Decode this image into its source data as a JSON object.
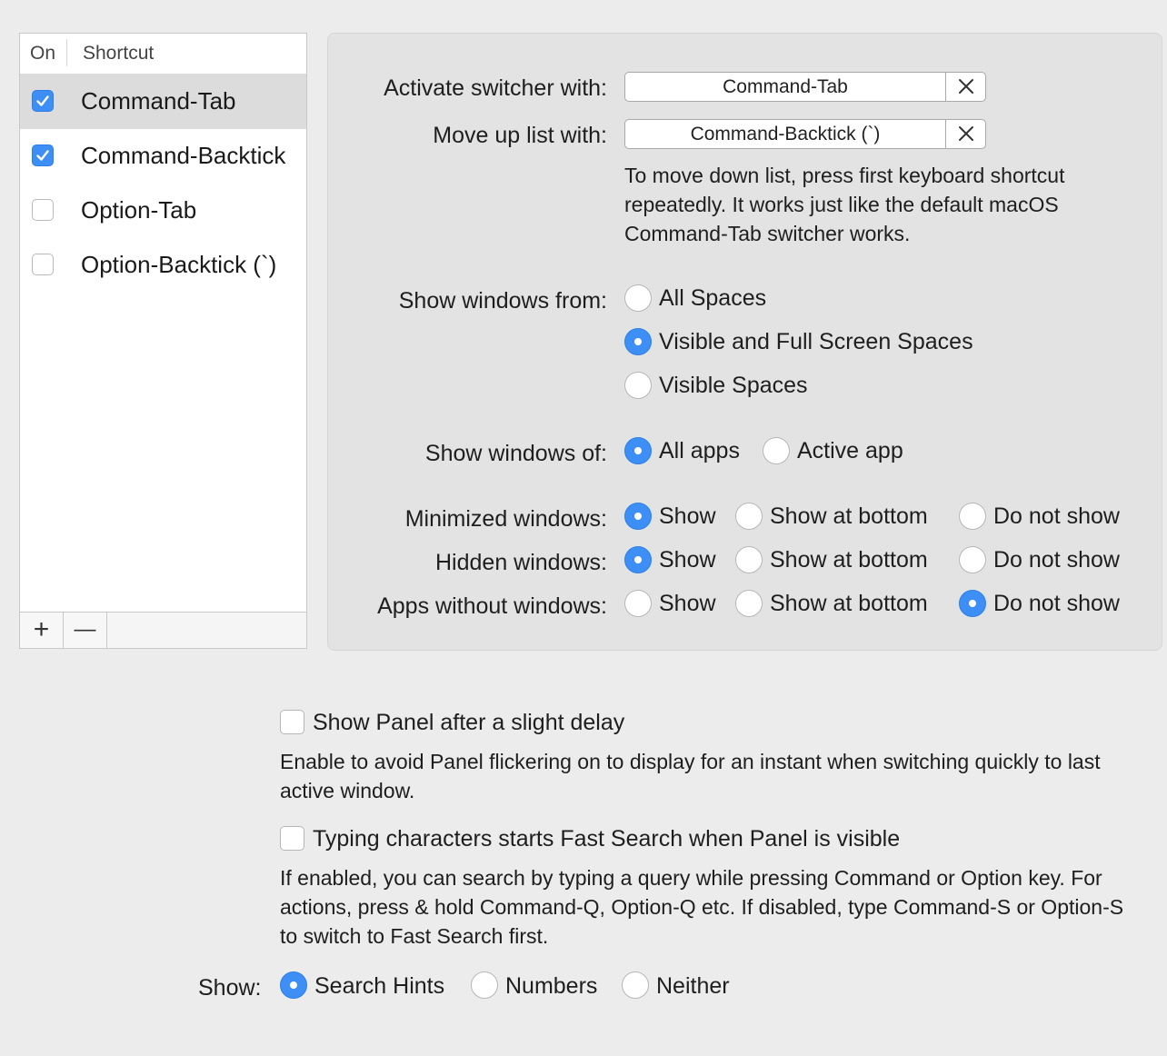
{
  "shortcut_list": {
    "header_on": "On",
    "header_shortcut": "Shortcut",
    "rows": [
      {
        "label": "Command-Tab",
        "checked": true,
        "selected": true
      },
      {
        "label": "Command-Backtick",
        "checked": true,
        "selected": false
      },
      {
        "label": "Option-Tab",
        "checked": false,
        "selected": false
      },
      {
        "label": "Option-Backtick (`)",
        "checked": false,
        "selected": false
      }
    ],
    "add_label": "+",
    "remove_label": "—"
  },
  "panel": {
    "activate_label": "Activate switcher with:",
    "activate_value": "Command-Tab",
    "moveup_label": "Move up list with:",
    "moveup_value": "Command-Backtick (`)",
    "movedown_hint": "To move down list, press first keyboard shortcut repeatedly. It works just like the default macOS Command-Tab switcher works.",
    "show_from_label": "Show windows from:",
    "show_from_options": [
      "All Spaces",
      "Visible and Full Screen Spaces",
      "Visible Spaces"
    ],
    "show_from_selected": 1,
    "show_of_label": "Show windows of:",
    "show_of_options": [
      "All apps",
      "Active app"
    ],
    "show_of_selected": 0,
    "minimized_label": "Minimized windows:",
    "hidden_label": "Hidden windows:",
    "apps_label": "Apps without windows:",
    "visibility_options": [
      "Show",
      "Show at bottom",
      "Do not show"
    ],
    "minimized_selected": 0,
    "hidden_selected": 0,
    "apps_selected": 2
  },
  "bottom": {
    "delay_label": "Show Panel after a slight delay",
    "delay_checked": false,
    "delay_desc": "Enable to avoid Panel flickering on to display for an instant when switching quickly to last active window.",
    "fastsearch_label": "Typing characters starts Fast Search when Panel is visible",
    "fastsearch_checked": false,
    "fastsearch_desc": "If enabled, you can search by typing a query while pressing Command or Option key. For actions, press & hold Command-Q, Option-Q etc. If disabled, type Command-S or Option-S to switch to Fast Search first.",
    "show_label": "Show:",
    "show_options": [
      "Search Hints",
      "Numbers",
      "Neither"
    ],
    "show_selected": 0
  },
  "colors": {
    "accent": "#3d8ff5",
    "background": "#ececec",
    "panel": "#e3e3e3",
    "selected_row": "#dcdcdc"
  },
  "icons": {
    "check": "checkmark-icon",
    "clear": "x-mark-icon"
  }
}
